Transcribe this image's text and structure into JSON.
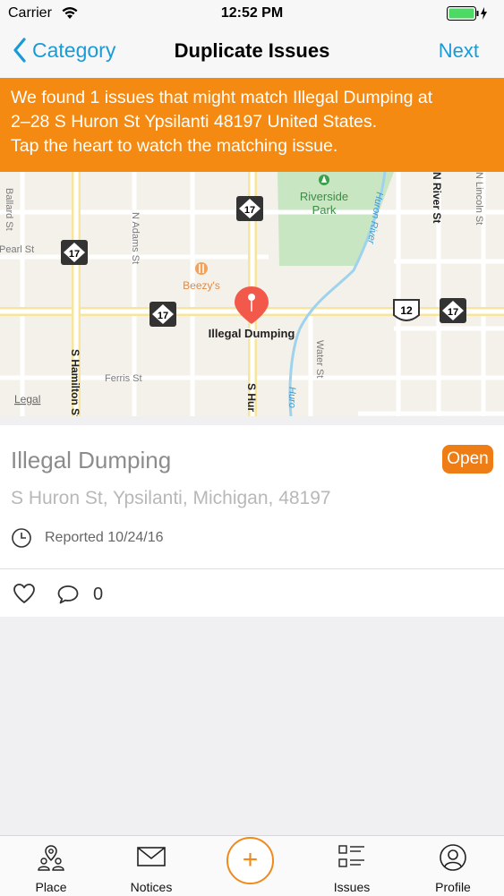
{
  "status_bar": {
    "carrier": "Carrier",
    "time": "12:52 PM",
    "wifi_icon": "wifi-icon",
    "battery_icon": "battery-icon",
    "charging_icon": "charging-bolt-icon"
  },
  "nav": {
    "back_label": "Category",
    "title": "Duplicate Issues",
    "next_label": "Next",
    "tint": "#1a9bd7"
  },
  "banner": {
    "lines": [
      "We found 1 issues that might match Illegal Dumping at",
      "2–28 S Huron St Ypsilanti 48197 United States.",
      "Tap the heart to watch the matching issue."
    ],
    "color": "#f58a12"
  },
  "map": {
    "park_name_1": "Riverside",
    "park_name_2": "Park",
    "poi": "Beezy's",
    "pin_label": "Illegal Dumping",
    "legal": "Legal",
    "route_17": "17",
    "route_12": "12",
    "streets": {
      "ballard": "Ballard St",
      "pearl": "Pearl St",
      "adams": "N Adams St",
      "hamilton": "S Hamilton St",
      "ferris": "Ferris St",
      "s_huron": "S Hur",
      "water": "Water St",
      "huron_river": "Huron River",
      "huron_river_2": "Huro",
      "n_river": "N River St",
      "lincoln": "N Lincoln St"
    }
  },
  "issue": {
    "title": "Illegal Dumping",
    "status": "Open",
    "address": "S Huron St, Ypsilanti, Michigan, 48197",
    "reported": "Reported 10/24/16",
    "comment_count": "0"
  },
  "tabs": [
    {
      "label": "Place",
      "icon": "place-icon"
    },
    {
      "label": "Notices",
      "icon": "mail-icon"
    },
    {
      "label": "",
      "icon": "plus-icon"
    },
    {
      "label": "Issues",
      "icon": "issues-list-icon"
    },
    {
      "label": "Profile",
      "icon": "profile-icon"
    }
  ],
  "colors": {
    "accent_orange": "#f08a1c",
    "status_badge": "#ef7d16"
  }
}
